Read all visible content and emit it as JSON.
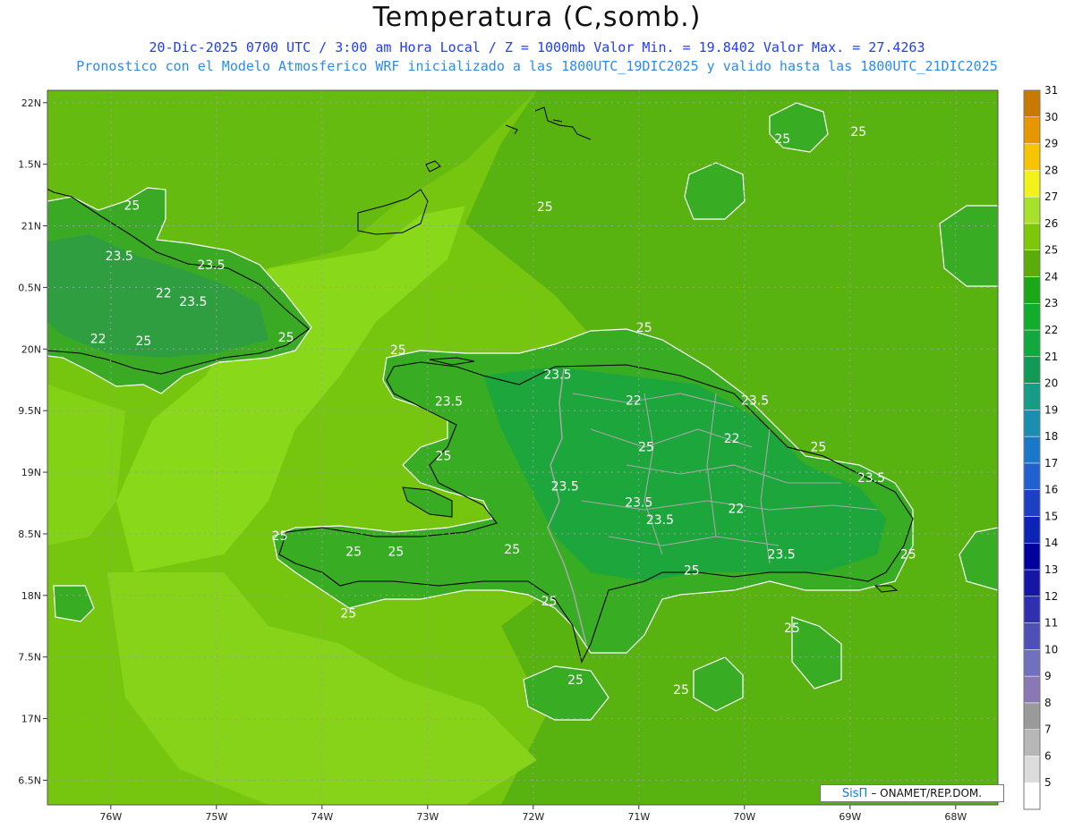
{
  "header": {
    "title": "Temperatura (C,somb.)",
    "line1": "20-Dic-2025  0700 UTC / 3:00 am Hora Local / Z = 1000mb   Valor Min. = 19.8402  Valor Max. = 27.4263",
    "line2": "Pronostico con el Modelo Atmosferico WRF inicializado a las 1800UTC_19DIC2025 y valido hasta las  1800UTC_21DIC2025"
  },
  "map": {
    "lon_ticks": [
      "76W",
      "75W",
      "74W",
      "73W",
      "72W",
      "71W",
      "70W",
      "69W",
      "68W"
    ],
    "lat_ticks": [
      "22N",
      "1.5N",
      "21N",
      "0.5N",
      "20N",
      "9.5N",
      "19N",
      "8.5N",
      "18N",
      "7.5N",
      "17N",
      "6.5N"
    ],
    "contour_labels": [
      {
        "text": "25",
        "lon": -75.8,
        "lat": 21.13
      },
      {
        "text": "23.5",
        "lon": -75.92,
        "lat": 20.72
      },
      {
        "text": "23.5",
        "lon": -75.05,
        "lat": 20.65
      },
      {
        "text": "22",
        "lon": -75.5,
        "lat": 20.42
      },
      {
        "text": "23.5",
        "lon": -75.22,
        "lat": 20.35
      },
      {
        "text": "22",
        "lon": -76.12,
        "lat": 20.05
      },
      {
        "text": "25",
        "lon": -75.69,
        "lat": 20.03
      },
      {
        "text": "25",
        "lon": -74.34,
        "lat": 20.06
      },
      {
        "text": "25",
        "lon": -73.28,
        "lat": 19.96
      },
      {
        "text": "23.5",
        "lon": -71.77,
        "lat": 19.76
      },
      {
        "text": "23.5",
        "lon": -72.8,
        "lat": 19.54
      },
      {
        "text": "22",
        "lon": -71.05,
        "lat": 19.55
      },
      {
        "text": "23.5",
        "lon": -69.9,
        "lat": 19.55
      },
      {
        "text": "25",
        "lon": -70.95,
        "lat": 20.14
      },
      {
        "text": "25",
        "lon": -71.89,
        "lat": 21.12
      },
      {
        "text": "25",
        "lon": -69.64,
        "lat": 21.67
      },
      {
        "text": "25",
        "lon": -68.92,
        "lat": 21.73
      },
      {
        "text": "25",
        "lon": -72.85,
        "lat": 19.1
      },
      {
        "text": "25",
        "lon": -70.93,
        "lat": 19.17
      },
      {
        "text": "22",
        "lon": -70.12,
        "lat": 19.24
      },
      {
        "text": "25",
        "lon": -69.3,
        "lat": 19.17
      },
      {
        "text": "23.5",
        "lon": -71.7,
        "lat": 18.85
      },
      {
        "text": "23.5",
        "lon": -71.0,
        "lat": 18.72
      },
      {
        "text": "23.5",
        "lon": -70.8,
        "lat": 18.58
      },
      {
        "text": "22",
        "lon": -70.08,
        "lat": 18.67
      },
      {
        "text": "23.5",
        "lon": -68.8,
        "lat": 18.92
      },
      {
        "text": "25",
        "lon": -74.4,
        "lat": 18.45
      },
      {
        "text": "25",
        "lon": -73.7,
        "lat": 18.32
      },
      {
        "text": "25",
        "lon": -73.3,
        "lat": 18.32
      },
      {
        "text": "25",
        "lon": -72.2,
        "lat": 18.34
      },
      {
        "text": "23.5",
        "lon": -69.65,
        "lat": 18.3
      },
      {
        "text": "25",
        "lon": -68.45,
        "lat": 18.3
      },
      {
        "text": "25",
        "lon": -70.5,
        "lat": 18.17
      },
      {
        "text": "25",
        "lon": -71.85,
        "lat": 17.92
      },
      {
        "text": "25",
        "lon": -73.75,
        "lat": 17.82
      },
      {
        "text": "25",
        "lon": -69.55,
        "lat": 17.7
      },
      {
        "text": "25",
        "lon": -71.6,
        "lat": 17.28
      },
      {
        "text": "25",
        "lon": -70.6,
        "lat": 17.2
      }
    ]
  },
  "colorbar": {
    "labels": [
      "5",
      "6",
      "7",
      "8",
      "9",
      "10",
      "11",
      "12",
      "13",
      "14",
      "15",
      "16",
      "17",
      "18",
      "19",
      "20",
      "21",
      "22",
      "23",
      "24",
      "25",
      "26",
      "27",
      "28",
      "29",
      "30",
      "31"
    ],
    "colors": [
      "#ffffff",
      "#dcdcdc",
      "#b7b7b7",
      "#9a9a9a",
      "#8a78b4",
      "#7170bf",
      "#4f4fb8",
      "#2f30b0",
      "#1616a6",
      "#00009e",
      "#0d23b6",
      "#1c3fc4",
      "#2060d0",
      "#1a78c8",
      "#1a8eb0",
      "#169b86",
      "#109a56",
      "#11a83d",
      "#12ad2a",
      "#1aa818",
      "#5aac08",
      "#7ec608",
      "#a8e12b",
      "#f2f21b",
      "#f7c400",
      "#e69700",
      "#c87a00"
    ]
  },
  "colors": {
    "sea": "#76c50e",
    "sea_light": "#8ad81a",
    "land": "#38ac23",
    "land_warm": "#18a22d",
    "coast": "#000000",
    "borders": "#a8a8a8",
    "contours": "#ffffff"
  },
  "footer": {
    "brand": "SisΠ",
    "credit": "– ONAMET/REP.DOM."
  }
}
